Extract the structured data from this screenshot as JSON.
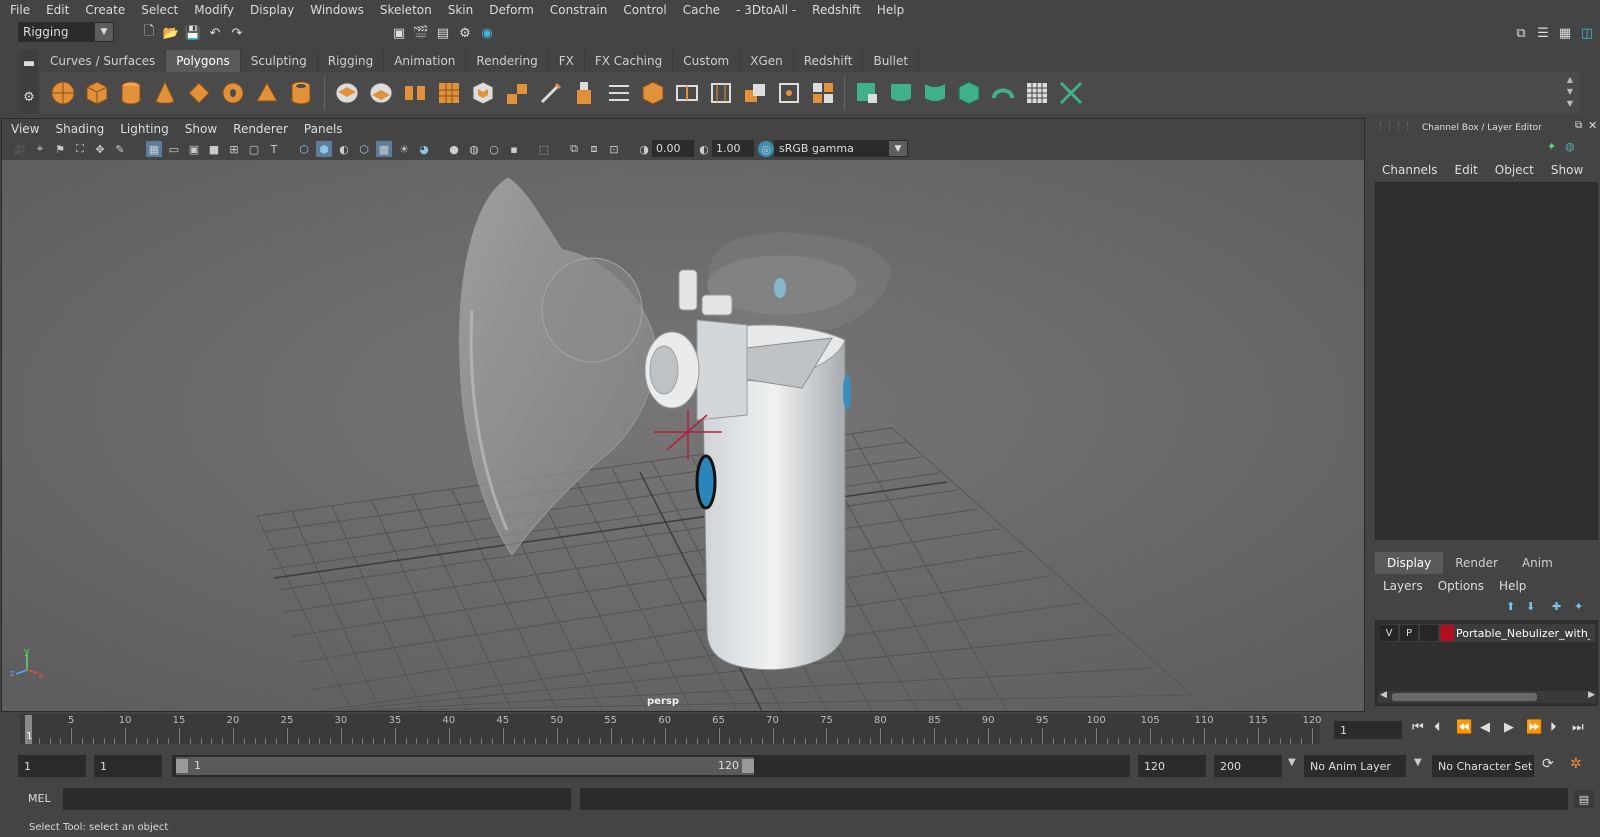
{
  "menubar": {
    "items": [
      "File",
      "Edit",
      "Create",
      "Select",
      "Modify",
      "Display",
      "Windows",
      "Skeleton",
      "Skin",
      "Deform",
      "Constrain",
      "Control",
      "Cache",
      "- 3DtoAll -",
      "Redshift",
      "Help"
    ]
  },
  "statusline": {
    "menuset": "Rigging"
  },
  "shelf": {
    "tabs": [
      "Curves / Surfaces",
      "Polygons",
      "Sculpting",
      "Rigging",
      "Animation",
      "Rendering",
      "FX",
      "FX Caching",
      "Custom",
      "XGen",
      "Redshift",
      "Bullet"
    ],
    "active_tab": "Polygons"
  },
  "viewport": {
    "menu": [
      "View",
      "Shading",
      "Lighting",
      "Show",
      "Renderer",
      "Panels"
    ],
    "exposure": "0.00",
    "gamma": "1.00",
    "color_space": "sRGB gamma",
    "camera_label": "persp",
    "axis_y": "y",
    "axis_z": "z",
    "axis_x": "x"
  },
  "channelbox": {
    "title": "Channel Box / Layer Editor",
    "menu": [
      "Channels",
      "Edit",
      "Object",
      "Show"
    ]
  },
  "layer_editor": {
    "tabs": [
      "Display",
      "Render",
      "Anim"
    ],
    "active_tab": "Display",
    "menu": [
      "Layers",
      "Options",
      "Help"
    ],
    "layer": {
      "v": "V",
      "p": "P",
      "name": "Portable_Nebulizer_with_M",
      "color": "#b01020"
    }
  },
  "timeline": {
    "ticks": [
      "5",
      "10",
      "15",
      "20",
      "25",
      "30",
      "35",
      "40",
      "45",
      "50",
      "55",
      "60",
      "65",
      "70",
      "75",
      "80",
      "85",
      "90",
      "95",
      "100",
      "105",
      "110",
      "115",
      "120"
    ],
    "start_label": "1",
    "current_frame": "1",
    "range_start": "1",
    "range_playback_start": "1",
    "slider_start": "1",
    "slider_end": "120",
    "range_end": "120",
    "anim_end": "200",
    "anim_layer": "No Anim Layer",
    "character_set": "No Character Set"
  },
  "cmdline": {
    "label": "MEL"
  },
  "helpline": {
    "text": "Select Tool: select an object"
  }
}
